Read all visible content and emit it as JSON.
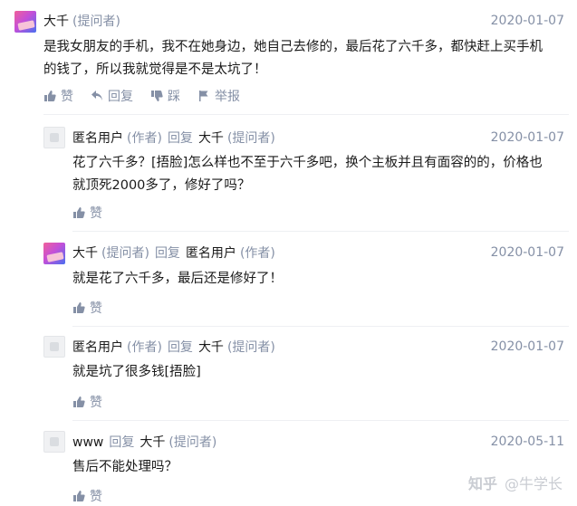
{
  "comments": [
    {
      "author": "大千",
      "author_role": "(提问者)",
      "date": "2020-01-07",
      "text_line1": "是我女朋友的手机，我不在她身边，她自己去修的，最后花了六千多，都快赶上买手机",
      "text_line2": "的钱了，所以我就觉得是不是太坑了！",
      "actions": {
        "like": "赞",
        "reply": "回复",
        "dislike": "踩",
        "report": "举报"
      }
    },
    {
      "author": "匿名用户",
      "author_role": "(作者)",
      "reply_word": "回复",
      "reply_to": "大千",
      "reply_to_role": "(提问者)",
      "date": "2020-01-07",
      "text_line1": "花了六千多？[捂脸]怎么样也不至于六千多吧，换个主板并且有面容的的，价格也",
      "text_line2": "就顶死2000多了，修好了吗？",
      "like": "赞"
    },
    {
      "author": "大千",
      "author_role": "(提问者)",
      "reply_word": "回复",
      "reply_to": "匿名用户",
      "reply_to_role": "(作者)",
      "date": "2020-01-07",
      "text_line1": "就是花了六千多，最后还是修好了！",
      "like": "赞"
    },
    {
      "author": "匿名用户",
      "author_role": "(作者)",
      "reply_word": "回复",
      "reply_to": "大千",
      "reply_to_role": "(提问者)",
      "date": "2020-01-07",
      "text_line1": "就是坑了很多钱[捂脸]",
      "like": "赞"
    },
    {
      "author": "www",
      "reply_word": "回复",
      "reply_to": "大千",
      "reply_to_role": "(提问者)",
      "date": "2020-05-11",
      "text_line1": "售后不能处理吗？",
      "like": "赞"
    }
  ],
  "watermark": {
    "logo": "知乎",
    "user": "@牛学长"
  },
  "colors": {
    "meta_gray": "#8590a6",
    "divider": "#eef0f3",
    "text": "#1a1a1a"
  }
}
